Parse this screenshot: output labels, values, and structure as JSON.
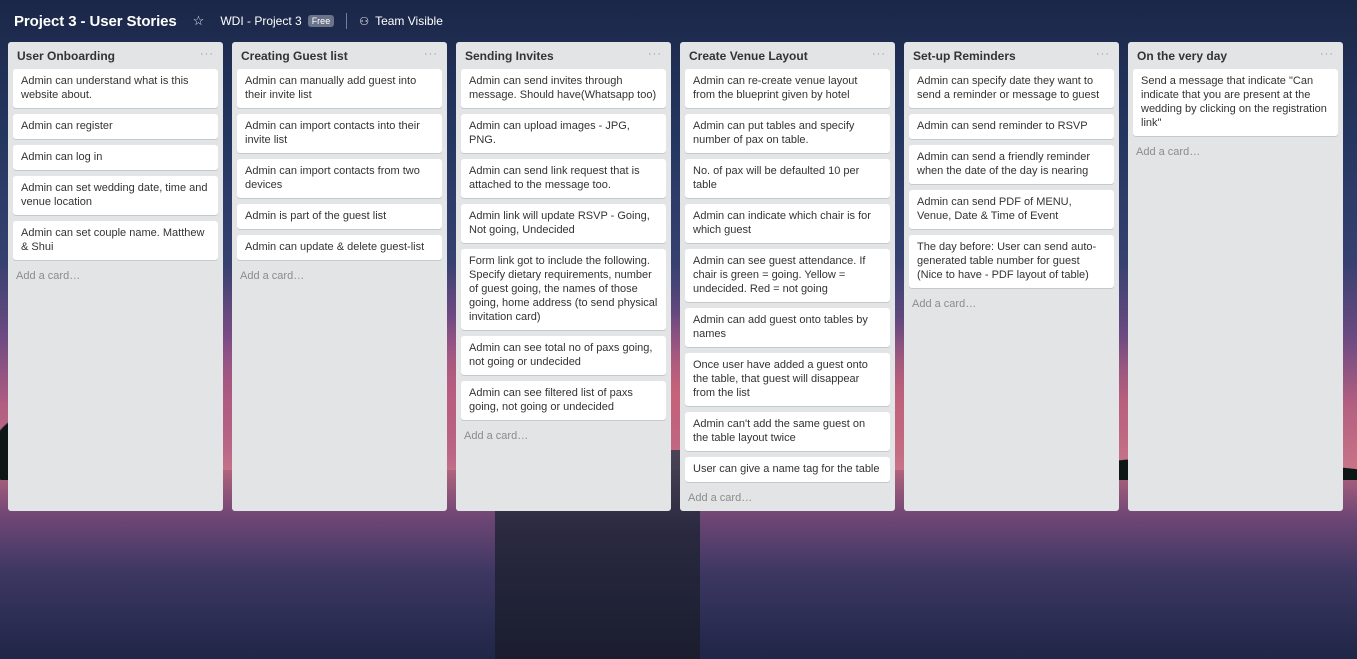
{
  "header": {
    "board_title": "Project 3 - User Stories",
    "org_name": "WDI - Project 3",
    "org_badge": "Free",
    "visibility_label": "Team Visible",
    "star_icon": "star-outline-icon",
    "visibility_icon": "team-icon"
  },
  "lists": [
    {
      "title": "User Onboarding",
      "cards": [
        "Admin can understand what is this website about.",
        "Admin can register",
        "Admin can log in",
        "Admin can set wedding date, time and venue location",
        "Admin can set couple name. Matthew & Shui"
      ],
      "add_label": "Add a card…"
    },
    {
      "title": "Creating Guest list",
      "cards": [
        "Admin can manually add guest into their invite list",
        "Admin can import contacts into their invite list",
        "Admin can import contacts from two devices",
        "Admin is part of the guest list",
        "Admin can update & delete guest-list"
      ],
      "add_label": "Add a card…"
    },
    {
      "title": "Sending Invites",
      "cards": [
        "Admin can send invites through message. Should have(Whatsapp too)",
        "Admin can upload images - JPG, PNG.",
        "Admin can send link request that is attached to the message too.",
        "Admin link will update RSVP - Going, Not going, Undecided",
        "Form link got to include the following. Specify dietary requirements, number of guest going, the names of those going, home address (to send physical invitation card)",
        "Admin can see total no of paxs going, not going or undecided",
        "Admin can see filtered list of paxs going, not going or undecided"
      ],
      "add_label": "Add a card…"
    },
    {
      "title": "Create Venue Layout",
      "cards": [
        "Admin can re-create venue layout from the blueprint given by hotel",
        "Admin can put tables and specify number of pax on table.",
        "No. of pax will be defaulted 10 per table",
        "Admin can indicate which chair is for which guest",
        "Admin can see guest attendance. If chair is green = going. Yellow = undecided. Red = not going",
        "Admin can add guest onto tables by names",
        "Once user have added a guest onto the table, that guest will disappear from the list",
        "Admin can't add the same guest on the table layout twice",
        "User can give a name tag for the table"
      ],
      "add_label": "Add a card…"
    },
    {
      "title": "Set-up Reminders",
      "cards": [
        "Admin can specify date they want to send a reminder or message to guest",
        "Admin can send reminder to RSVP",
        "Admin can send a friendly reminder when the date of the day is nearing",
        "Admin can send PDF of MENU, Venue, Date & Time of Event",
        "The day before: User can send auto-generated table number for guest (Nice to have - PDF layout of table)"
      ],
      "add_label": "Add a card…"
    },
    {
      "title": "On the very day",
      "cards": [
        "Send a message that indicate \"Can indicate that you are present at the wedding by clicking on the registration link\""
      ],
      "add_label": "Add a card…"
    }
  ]
}
